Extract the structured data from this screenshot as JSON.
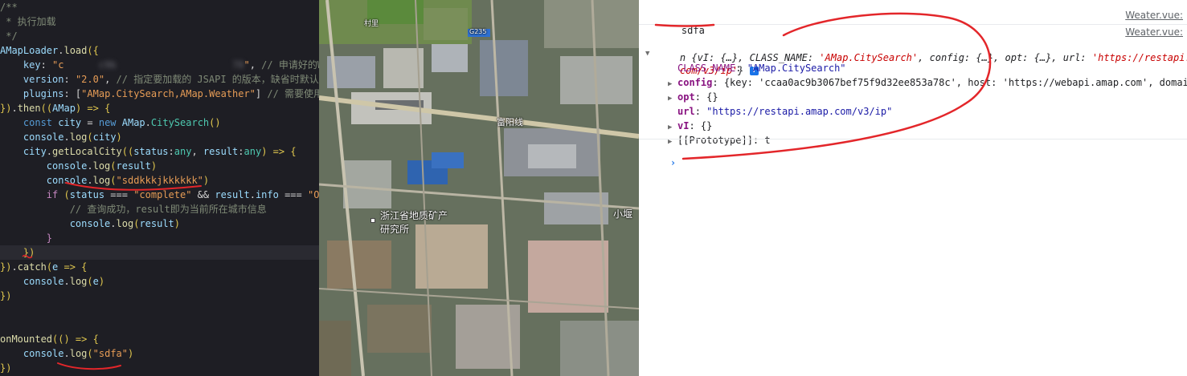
{
  "editor": {
    "lines": [
      {
        "segs": [
          {
            "t": "/**",
            "c": "comment"
          }
        ]
      },
      {
        "segs": [
          {
            "t": " * 执行加载",
            "c": "comment"
          }
        ]
      },
      {
        "segs": [
          {
            "t": " */",
            "c": "comment"
          }
        ]
      },
      {
        "segs": [
          {
            "t": "AMapLoader",
            "c": "param"
          },
          {
            "t": ".",
            "c": ""
          },
          {
            "t": "load",
            "c": "fn"
          },
          {
            "t": "({",
            "c": "punc"
          }
        ]
      },
      {
        "segs": [
          {
            "t": "    key",
            "c": "key"
          },
          {
            "t": ": ",
            "c": ""
          },
          {
            "t": "\"c",
            "c": "string"
          },
          {
            "t": "      c9b",
            "c": "blurred"
          },
          {
            "t": "                    78",
            "c": "blurred"
          },
          {
            "t": "\"",
            "c": "string"
          },
          {
            "t": ", ",
            "c": ""
          },
          {
            "t": "// 申请好的W",
            "c": "comment"
          }
        ]
      },
      {
        "segs": [
          {
            "t": "    version",
            "c": "key"
          },
          {
            "t": ": ",
            "c": ""
          },
          {
            "t": "\"2.0\"",
            "c": "string"
          },
          {
            "t": ", ",
            "c": ""
          },
          {
            "t": "// 指定要加载的 JSAPI 的版本，缺省时默认",
            "c": "comment"
          }
        ]
      },
      {
        "segs": [
          {
            "t": "    plugins",
            "c": "key"
          },
          {
            "t": ": [",
            "c": ""
          },
          {
            "t": "\"AMap.CitySearch,AMap.Weather\"",
            "c": "string"
          },
          {
            "t": "] ",
            "c": ""
          },
          {
            "t": "// 需要使用",
            "c": "comment"
          }
        ]
      },
      {
        "segs": [
          {
            "t": "})",
            "c": "punc"
          },
          {
            "t": ".",
            "c": ""
          },
          {
            "t": "then",
            "c": "fn"
          },
          {
            "t": "((",
            "c": "punc"
          },
          {
            "t": "AMap",
            "c": "param"
          },
          {
            "t": ") => {",
            "c": "punc"
          }
        ]
      },
      {
        "segs": [
          {
            "t": "    const ",
            "c": "kw2"
          },
          {
            "t": "city",
            "c": "param"
          },
          {
            "t": " = ",
            "c": ""
          },
          {
            "t": "new ",
            "c": "kw2"
          },
          {
            "t": "AMap",
            "c": "param"
          },
          {
            "t": ".",
            "c": ""
          },
          {
            "t": "CitySearch",
            "c": "type"
          },
          {
            "t": "()",
            "c": "punc"
          }
        ]
      },
      {
        "segs": [
          {
            "t": "    console",
            "c": "param"
          },
          {
            "t": ".",
            "c": ""
          },
          {
            "t": "log",
            "c": "fn"
          },
          {
            "t": "(",
            "c": "punc"
          },
          {
            "t": "city",
            "c": "param"
          },
          {
            "t": ")",
            "c": "punc"
          }
        ]
      },
      {
        "segs": [
          {
            "t": "    city",
            "c": "param"
          },
          {
            "t": ".",
            "c": ""
          },
          {
            "t": "getLocalCity",
            "c": "fn"
          },
          {
            "t": "((",
            "c": "punc"
          },
          {
            "t": "status",
            "c": "param"
          },
          {
            "t": ":",
            "c": ""
          },
          {
            "t": "any",
            "c": "type"
          },
          {
            "t": ", ",
            "c": ""
          },
          {
            "t": "result",
            "c": "param"
          },
          {
            "t": ":",
            "c": ""
          },
          {
            "t": "any",
            "c": "type"
          },
          {
            "t": ") => {",
            "c": "punc"
          }
        ]
      },
      {
        "segs": [
          {
            "t": "        console",
            "c": "param"
          },
          {
            "t": ".",
            "c": ""
          },
          {
            "t": "log",
            "c": "fn"
          },
          {
            "t": "(",
            "c": "punc"
          },
          {
            "t": "result",
            "c": "param"
          },
          {
            "t": ")",
            "c": "punc"
          }
        ]
      },
      {
        "segs": [
          {
            "t": "        console",
            "c": "param"
          },
          {
            "t": ".",
            "c": ""
          },
          {
            "t": "log",
            "c": "fn"
          },
          {
            "t": "(",
            "c": "punc"
          },
          {
            "t": "\"sddkkkjkkkkkk\"",
            "c": "string"
          },
          {
            "t": ")",
            "c": "punc"
          }
        ]
      },
      {
        "segs": [
          {
            "t": "        if ",
            "c": "kw"
          },
          {
            "t": "(",
            "c": "punc"
          },
          {
            "t": "status",
            "c": "param"
          },
          {
            "t": " === ",
            "c": ""
          },
          {
            "t": "\"complete\"",
            "c": "string"
          },
          {
            "t": " && ",
            "c": ""
          },
          {
            "t": "result",
            "c": "param"
          },
          {
            "t": ".",
            "c": ""
          },
          {
            "t": "info",
            "c": "param"
          },
          {
            "t": " === ",
            "c": ""
          },
          {
            "t": "\"O",
            "c": "string"
          }
        ]
      },
      {
        "segs": [
          {
            "t": "            // 查询成功，result即为当前所在城市信息",
            "c": "comment"
          }
        ]
      },
      {
        "segs": [
          {
            "t": "            console",
            "c": "param"
          },
          {
            "t": ".",
            "c": ""
          },
          {
            "t": "log",
            "c": "fn"
          },
          {
            "t": "(",
            "c": "punc"
          },
          {
            "t": "result",
            "c": "param"
          },
          {
            "t": ")",
            "c": "punc"
          }
        ]
      },
      {
        "segs": [
          {
            "t": "        }",
            "c": "kw"
          }
        ]
      },
      {
        "segs": [
          {
            "t": "    })",
            "c": "punc"
          }
        ]
      },
      {
        "segs": [
          {
            "t": "})",
            "c": "punc"
          },
          {
            "t": ".",
            "c": ""
          },
          {
            "t": "catch",
            "c": "fn"
          },
          {
            "t": "(",
            "c": "punc"
          },
          {
            "t": "e",
            "c": "param"
          },
          {
            "t": " => {",
            "c": "punc"
          }
        ]
      },
      {
        "segs": [
          {
            "t": "    console",
            "c": "param"
          },
          {
            "t": ".",
            "c": ""
          },
          {
            "t": "log",
            "c": "fn"
          },
          {
            "t": "(",
            "c": "punc"
          },
          {
            "t": "e",
            "c": "param"
          },
          {
            "t": ")",
            "c": "punc"
          }
        ]
      },
      {
        "segs": [
          {
            "t": "})",
            "c": "punc"
          }
        ]
      },
      {
        "segs": []
      },
      {
        "segs": []
      },
      {
        "segs": [
          {
            "t": "onMounted",
            "c": "fn"
          },
          {
            "t": "(() => {",
            "c": "punc"
          }
        ]
      },
      {
        "segs": [
          {
            "t": "    console",
            "c": "param"
          },
          {
            "t": ".",
            "c": ""
          },
          {
            "t": "log",
            "c": "fn"
          },
          {
            "t": "(",
            "c": "punc"
          },
          {
            "t": "\"sdfa\"",
            "c": "string"
          },
          {
            "t": ")",
            "c": "punc"
          }
        ]
      },
      {
        "segs": [
          {
            "t": "})",
            "c": "punc"
          }
        ]
      }
    ]
  },
  "map": {
    "labels": [
      {
        "text": "村里"
      },
      {
        "text": "G235"
      },
      {
        "text": "富阳线"
      },
      {
        "text": "浙江省地质矿产"
      },
      {
        "text": "研究所"
      },
      {
        "text": "小堰"
      }
    ]
  },
  "console": {
    "log1": {
      "text": "sdfa",
      "source": "Weater.vue:"
    },
    "log2": {
      "source": "Weater.vue:",
      "summary_prefix": "n {vI: {…}, CLASS_NAME: ",
      "summary_class": "'AMap.CitySearch'",
      "summary_mid": ", config: {…}, opt: {…}, url: ",
      "summary_url": "'https://restapi.am",
      "summary_url_cont": "com/v3/ip'",
      "summary_end": "}",
      "info_badge": "i",
      "props": [
        {
          "key": "CLASS_NAME",
          "value": "\"AMap.CitySearch\"",
          "expandable": false
        },
        {
          "key": "config",
          "value": "{key: 'ccaa0ac9b3067bef75f9d32ee853a78c', host: 'https://webapi.amap.com', domai",
          "expandable": true
        },
        {
          "key": "opt",
          "value": "{}",
          "expandable": true
        },
        {
          "key": "url",
          "value": "\"https://restapi.amap.com/v3/ip\"",
          "expandable": false
        },
        {
          "key": "vI",
          "value": "{}",
          "expandable": true
        },
        {
          "key": "[[Prototype]]",
          "value": "t",
          "expandable": true
        }
      ]
    },
    "prompt": "›"
  },
  "colors": {
    "annotation": "#e3262a",
    "editor_bg": "#1e1e24",
    "console_link": "#1a73e8"
  }
}
